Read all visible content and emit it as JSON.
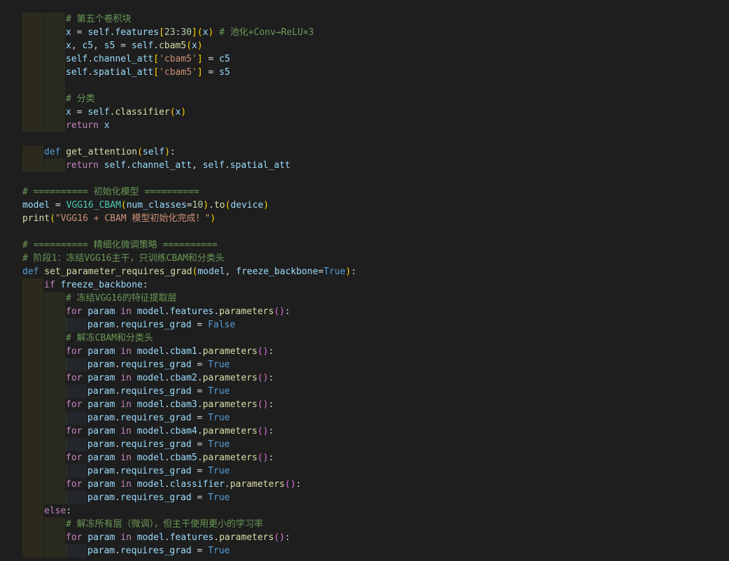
{
  "editor": {
    "language": "python",
    "lines": [
      {
        "indent": 2,
        "tokens": [
          [
            "com",
            "# 第五个卷积块"
          ]
        ]
      },
      {
        "indent": 2,
        "tokens": [
          [
            "var",
            "x"
          ],
          [
            "punc",
            " = "
          ],
          [
            "var",
            "self"
          ],
          [
            "punc",
            "."
          ],
          [
            "var",
            "features"
          ],
          [
            "br",
            "["
          ],
          [
            "num",
            "23"
          ],
          [
            "punc",
            ":"
          ],
          [
            "num",
            "30"
          ],
          [
            "br",
            "]"
          ],
          [
            "br",
            "("
          ],
          [
            "var",
            "x"
          ],
          [
            "br",
            ")"
          ],
          [
            "punc",
            " "
          ],
          [
            "com",
            "# 池化+Conv→ReLU×3"
          ]
        ]
      },
      {
        "indent": 2,
        "tokens": [
          [
            "var",
            "x"
          ],
          [
            "punc",
            ", "
          ],
          [
            "var",
            "c5"
          ],
          [
            "punc",
            ", "
          ],
          [
            "var",
            "s5"
          ],
          [
            "punc",
            " = "
          ],
          [
            "var",
            "self"
          ],
          [
            "punc",
            "."
          ],
          [
            "fn",
            "cbam5"
          ],
          [
            "br",
            "("
          ],
          [
            "var",
            "x"
          ],
          [
            "br",
            ")"
          ]
        ]
      },
      {
        "indent": 2,
        "tokens": [
          [
            "var",
            "self"
          ],
          [
            "punc",
            "."
          ],
          [
            "var",
            "channel_att"
          ],
          [
            "br",
            "["
          ],
          [
            "str",
            "'cbam5'"
          ],
          [
            "br",
            "]"
          ],
          [
            "punc",
            " = "
          ],
          [
            "var",
            "c5"
          ]
        ]
      },
      {
        "indent": 2,
        "tokens": [
          [
            "var",
            "self"
          ],
          [
            "punc",
            "."
          ],
          [
            "var",
            "spatial_att"
          ],
          [
            "br",
            "["
          ],
          [
            "str",
            "'cbam5'"
          ],
          [
            "br",
            "]"
          ],
          [
            "punc",
            " = "
          ],
          [
            "var",
            "s5"
          ]
        ]
      },
      {
        "indent": 2,
        "tokens": []
      },
      {
        "indent": 2,
        "tokens": [
          [
            "com",
            "# 分类"
          ]
        ]
      },
      {
        "indent": 2,
        "tokens": [
          [
            "var",
            "x"
          ],
          [
            "punc",
            " = "
          ],
          [
            "var",
            "self"
          ],
          [
            "punc",
            "."
          ],
          [
            "fn",
            "classifier"
          ],
          [
            "br",
            "("
          ],
          [
            "var",
            "x"
          ],
          [
            "br",
            ")"
          ]
        ]
      },
      {
        "indent": 2,
        "tokens": [
          [
            "ctrl",
            "return"
          ],
          [
            "punc",
            " "
          ],
          [
            "var",
            "x"
          ]
        ]
      },
      {
        "indent": 0,
        "tokens": []
      },
      {
        "indent": 1,
        "tokens": [
          [
            "kw",
            "def"
          ],
          [
            "punc",
            " "
          ],
          [
            "fn",
            "get_attention"
          ],
          [
            "br",
            "("
          ],
          [
            "var",
            "self"
          ],
          [
            "br",
            ")"
          ],
          [
            "punc",
            ":"
          ]
        ]
      },
      {
        "indent": 2,
        "tokens": [
          [
            "ctrl",
            "return"
          ],
          [
            "punc",
            " "
          ],
          [
            "var",
            "self"
          ],
          [
            "punc",
            "."
          ],
          [
            "var",
            "channel_att"
          ],
          [
            "punc",
            ", "
          ],
          [
            "var",
            "self"
          ],
          [
            "punc",
            "."
          ],
          [
            "var",
            "spatial_att"
          ]
        ]
      },
      {
        "indent": 0,
        "tokens": []
      },
      {
        "indent": 0,
        "tokens": [
          [
            "com",
            "# ========== 初始化模型 =========="
          ]
        ]
      },
      {
        "indent": 0,
        "tokens": [
          [
            "var",
            "model"
          ],
          [
            "punc",
            " = "
          ],
          [
            "cls",
            "VGG16_CBAM"
          ],
          [
            "br",
            "("
          ],
          [
            "var",
            "num_classes"
          ],
          [
            "punc",
            "="
          ],
          [
            "num",
            "10"
          ],
          [
            "br",
            ")"
          ],
          [
            "punc",
            "."
          ],
          [
            "fn",
            "to"
          ],
          [
            "br",
            "("
          ],
          [
            "var",
            "device"
          ],
          [
            "br",
            ")"
          ]
        ]
      },
      {
        "indent": 0,
        "tokens": [
          [
            "fn",
            "print"
          ],
          [
            "br",
            "("
          ],
          [
            "str",
            "\"VGG16 + CBAM 模型初始化完成！\""
          ],
          [
            "br",
            ")"
          ]
        ]
      },
      {
        "indent": 0,
        "tokens": []
      },
      {
        "indent": 0,
        "tokens": [
          [
            "com",
            "# ========== 精细化微调策略 =========="
          ]
        ]
      },
      {
        "indent": 0,
        "tokens": [
          [
            "com",
            "# 阶段1：冻结VGG16主干，只训练CBAM和分类头"
          ]
        ]
      },
      {
        "indent": 0,
        "tokens": [
          [
            "kw",
            "def"
          ],
          [
            "punc",
            " "
          ],
          [
            "fn",
            "set_parameter_requires_grad"
          ],
          [
            "br",
            "("
          ],
          [
            "var",
            "model"
          ],
          [
            "punc",
            ", "
          ],
          [
            "var",
            "freeze_backbone"
          ],
          [
            "punc",
            "="
          ],
          [
            "bool",
            "True"
          ],
          [
            "br",
            ")"
          ],
          [
            "punc",
            ":"
          ]
        ]
      },
      {
        "indent": 1,
        "tokens": [
          [
            "ctrl",
            "if"
          ],
          [
            "punc",
            " "
          ],
          [
            "var",
            "freeze_backbone"
          ],
          [
            "punc",
            ":"
          ]
        ]
      },
      {
        "indent": 2,
        "tokens": [
          [
            "com",
            "# 冻结VGG16的特征提取层"
          ]
        ]
      },
      {
        "indent": 2,
        "tokens": [
          [
            "ctrl",
            "for"
          ],
          [
            "punc",
            " "
          ],
          [
            "var",
            "param"
          ],
          [
            "punc",
            " "
          ],
          [
            "ctrl",
            "in"
          ],
          [
            "punc",
            " "
          ],
          [
            "var",
            "model"
          ],
          [
            "punc",
            "."
          ],
          [
            "var",
            "features"
          ],
          [
            "punc",
            "."
          ],
          [
            "fn",
            "parameters"
          ],
          [
            "br2",
            "()"
          ],
          [
            "punc",
            ":"
          ]
        ]
      },
      {
        "indent": 3,
        "tokens": [
          [
            "var",
            "param"
          ],
          [
            "punc",
            "."
          ],
          [
            "var",
            "requires_grad"
          ],
          [
            "punc",
            " = "
          ],
          [
            "bool",
            "False"
          ]
        ]
      },
      {
        "indent": 2,
        "tokens": [
          [
            "com",
            "# 解冻CBAM和分类头"
          ]
        ]
      },
      {
        "indent": 2,
        "tokens": [
          [
            "ctrl",
            "for"
          ],
          [
            "punc",
            " "
          ],
          [
            "var",
            "param"
          ],
          [
            "punc",
            " "
          ],
          [
            "ctrl",
            "in"
          ],
          [
            "punc",
            " "
          ],
          [
            "var",
            "model"
          ],
          [
            "punc",
            "."
          ],
          [
            "var",
            "cbam1"
          ],
          [
            "punc",
            "."
          ],
          [
            "fn",
            "parameters"
          ],
          [
            "br2",
            "()"
          ],
          [
            "punc",
            ":"
          ]
        ]
      },
      {
        "indent": 3,
        "tokens": [
          [
            "var",
            "param"
          ],
          [
            "punc",
            "."
          ],
          [
            "var",
            "requires_grad"
          ],
          [
            "punc",
            " = "
          ],
          [
            "bool",
            "True"
          ]
        ]
      },
      {
        "indent": 2,
        "tokens": [
          [
            "ctrl",
            "for"
          ],
          [
            "punc",
            " "
          ],
          [
            "var",
            "param"
          ],
          [
            "punc",
            " "
          ],
          [
            "ctrl",
            "in"
          ],
          [
            "punc",
            " "
          ],
          [
            "var",
            "model"
          ],
          [
            "punc",
            "."
          ],
          [
            "var",
            "cbam2"
          ],
          [
            "punc",
            "."
          ],
          [
            "fn",
            "parameters"
          ],
          [
            "br2",
            "()"
          ],
          [
            "punc",
            ":"
          ]
        ]
      },
      {
        "indent": 3,
        "tokens": [
          [
            "var",
            "param"
          ],
          [
            "punc",
            "."
          ],
          [
            "var",
            "requires_grad"
          ],
          [
            "punc",
            " = "
          ],
          [
            "bool",
            "True"
          ]
        ]
      },
      {
        "indent": 2,
        "tokens": [
          [
            "ctrl",
            "for"
          ],
          [
            "punc",
            " "
          ],
          [
            "var",
            "param"
          ],
          [
            "punc",
            " "
          ],
          [
            "ctrl",
            "in"
          ],
          [
            "punc",
            " "
          ],
          [
            "var",
            "model"
          ],
          [
            "punc",
            "."
          ],
          [
            "var",
            "cbam3"
          ],
          [
            "punc",
            "."
          ],
          [
            "fn",
            "parameters"
          ],
          [
            "br2",
            "()"
          ],
          [
            "punc",
            ":"
          ]
        ]
      },
      {
        "indent": 3,
        "tokens": [
          [
            "var",
            "param"
          ],
          [
            "punc",
            "."
          ],
          [
            "var",
            "requires_grad"
          ],
          [
            "punc",
            " = "
          ],
          [
            "bool",
            "True"
          ]
        ]
      },
      {
        "indent": 2,
        "tokens": [
          [
            "ctrl",
            "for"
          ],
          [
            "punc",
            " "
          ],
          [
            "var",
            "param"
          ],
          [
            "punc",
            " "
          ],
          [
            "ctrl",
            "in"
          ],
          [
            "punc",
            " "
          ],
          [
            "var",
            "model"
          ],
          [
            "punc",
            "."
          ],
          [
            "var",
            "cbam4"
          ],
          [
            "punc",
            "."
          ],
          [
            "fn",
            "parameters"
          ],
          [
            "br2",
            "()"
          ],
          [
            "punc",
            ":"
          ]
        ]
      },
      {
        "indent": 3,
        "tokens": [
          [
            "var",
            "param"
          ],
          [
            "punc",
            "."
          ],
          [
            "var",
            "requires_grad"
          ],
          [
            "punc",
            " = "
          ],
          [
            "bool",
            "True"
          ]
        ]
      },
      {
        "indent": 2,
        "tokens": [
          [
            "ctrl",
            "for"
          ],
          [
            "punc",
            " "
          ],
          [
            "var",
            "param"
          ],
          [
            "punc",
            " "
          ],
          [
            "ctrl",
            "in"
          ],
          [
            "punc",
            " "
          ],
          [
            "var",
            "model"
          ],
          [
            "punc",
            "."
          ],
          [
            "var",
            "cbam5"
          ],
          [
            "punc",
            "."
          ],
          [
            "fn",
            "parameters"
          ],
          [
            "br2",
            "()"
          ],
          [
            "punc",
            ":"
          ]
        ]
      },
      {
        "indent": 3,
        "tokens": [
          [
            "var",
            "param"
          ],
          [
            "punc",
            "."
          ],
          [
            "var",
            "requires_grad"
          ],
          [
            "punc",
            " = "
          ],
          [
            "bool",
            "True"
          ]
        ]
      },
      {
        "indent": 2,
        "tokens": [
          [
            "ctrl",
            "for"
          ],
          [
            "punc",
            " "
          ],
          [
            "var",
            "param"
          ],
          [
            "punc",
            " "
          ],
          [
            "ctrl",
            "in"
          ],
          [
            "punc",
            " "
          ],
          [
            "var",
            "model"
          ],
          [
            "punc",
            "."
          ],
          [
            "var",
            "classifier"
          ],
          [
            "punc",
            "."
          ],
          [
            "fn",
            "parameters"
          ],
          [
            "br2",
            "()"
          ],
          [
            "punc",
            ":"
          ]
        ]
      },
      {
        "indent": 3,
        "tokens": [
          [
            "var",
            "param"
          ],
          [
            "punc",
            "."
          ],
          [
            "var",
            "requires_grad"
          ],
          [
            "punc",
            " = "
          ],
          [
            "bool",
            "True"
          ]
        ]
      },
      {
        "indent": 1,
        "tokens": [
          [
            "ctrl",
            "else"
          ],
          [
            "punc",
            ":"
          ]
        ]
      },
      {
        "indent": 2,
        "tokens": [
          [
            "com",
            "# 解冻所有层（微调），但主干使用更小的学习率"
          ]
        ]
      },
      {
        "indent": 2,
        "tokens": [
          [
            "ctrl",
            "for"
          ],
          [
            "punc",
            " "
          ],
          [
            "var",
            "param"
          ],
          [
            "punc",
            " "
          ],
          [
            "ctrl",
            "in"
          ],
          [
            "punc",
            " "
          ],
          [
            "var",
            "model"
          ],
          [
            "punc",
            "."
          ],
          [
            "var",
            "features"
          ],
          [
            "punc",
            "."
          ],
          [
            "fn",
            "parameters"
          ],
          [
            "br2",
            "()"
          ],
          [
            "punc",
            ":"
          ]
        ]
      },
      {
        "indent": 3,
        "tokens": [
          [
            "var",
            "param"
          ],
          [
            "punc",
            "."
          ],
          [
            "var",
            "requires_grad"
          ],
          [
            "punc",
            " = "
          ],
          [
            "bool",
            "True"
          ]
        ]
      }
    ]
  }
}
